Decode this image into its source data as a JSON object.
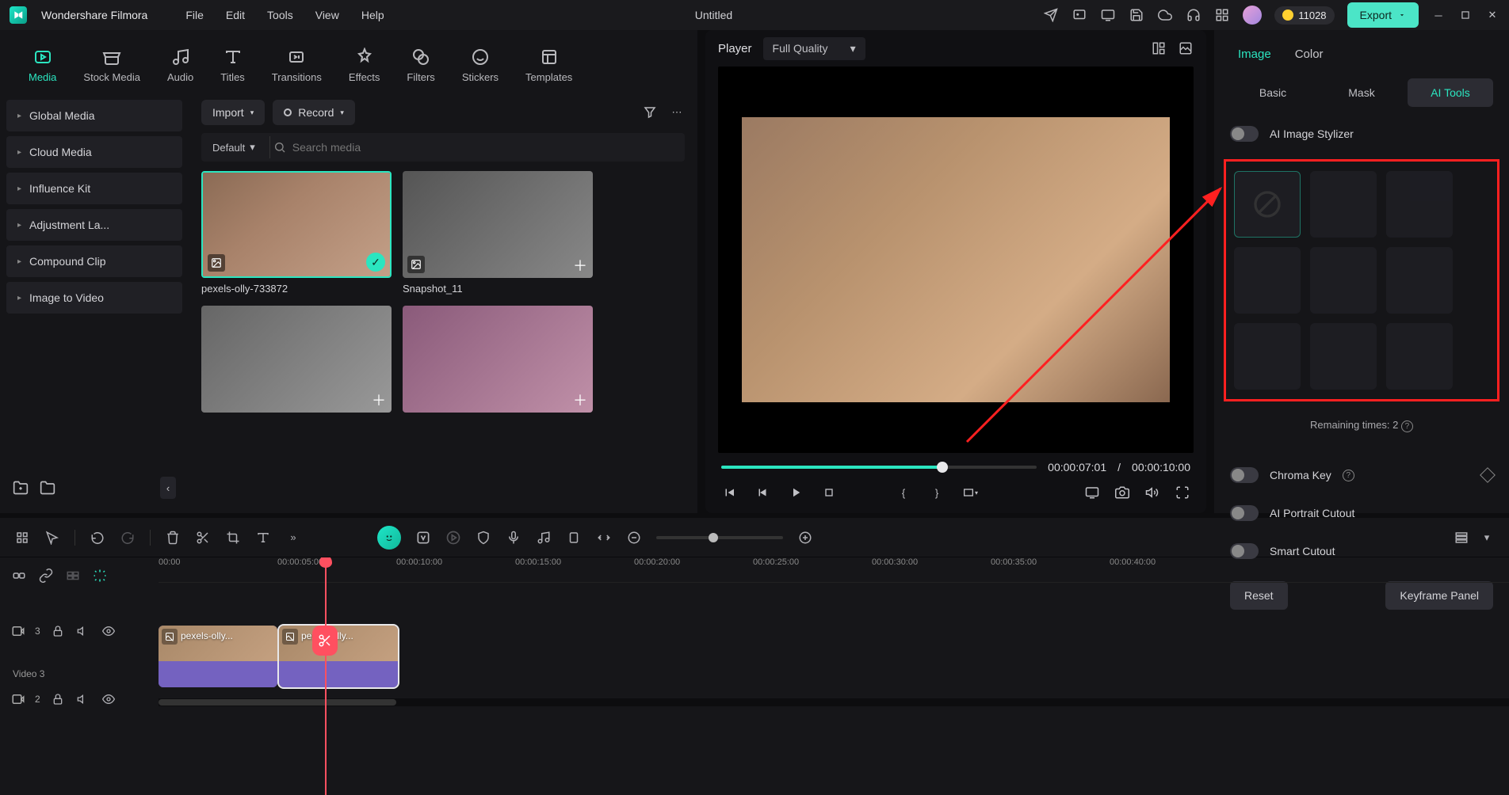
{
  "app": {
    "name": "Wondershare Filmora",
    "doc_title": "Untitled",
    "credits": "11028",
    "export": "Export"
  },
  "menu": [
    "File",
    "Edit",
    "Tools",
    "View",
    "Help"
  ],
  "top_tabs": [
    {
      "label": "Media",
      "active": true
    },
    {
      "label": "Stock Media"
    },
    {
      "label": "Audio"
    },
    {
      "label": "Titles"
    },
    {
      "label": "Transitions"
    },
    {
      "label": "Effects"
    },
    {
      "label": "Filters"
    },
    {
      "label": "Stickers"
    },
    {
      "label": "Templates"
    }
  ],
  "sidebar": {
    "items": [
      "Global Media",
      "Cloud Media",
      "Influence Kit",
      "Adjustment La...",
      "Compound Clip",
      "Image to Video"
    ]
  },
  "media_toolbar": {
    "import": "Import",
    "record": "Record",
    "default": "Default",
    "search_placeholder": "Search media"
  },
  "media_items": [
    {
      "label": "pexels-olly-733872",
      "selected": true,
      "checked": true
    },
    {
      "label": "Snapshot_11"
    }
  ],
  "preview": {
    "title": "Player",
    "quality": "Full Quality",
    "time_cur": "00:00:07:01",
    "time_sep": "/",
    "time_total": "00:00:10:00"
  },
  "right": {
    "tabs": [
      "Image",
      "Color"
    ],
    "active_tab": 0,
    "subtabs": [
      "Basic",
      "Mask",
      "AI Tools"
    ],
    "active_sub": 2,
    "ai_image": "AI Image Stylizer",
    "remaining": "Remaining times: 2",
    "chroma": "Chroma Key",
    "portrait": "AI Portrait Cutout",
    "smart": "Smart Cutout",
    "reset": "Reset",
    "keyframe": "Keyframe Panel"
  },
  "timeline": {
    "ruler": [
      "00:00",
      "00:00:05:00",
      "00:00:10:00",
      "00:00:15:00",
      "00:00:20:00",
      "00:00:25:00",
      "00:00:30:00",
      "00:00:35:00",
      "00:00:40:00"
    ],
    "track3": {
      "badge": "3",
      "label": "Video 3"
    },
    "track2": {
      "badge": "2"
    },
    "clip_a": "pexels-olly...",
    "clip_b": "pexels-olly..."
  }
}
